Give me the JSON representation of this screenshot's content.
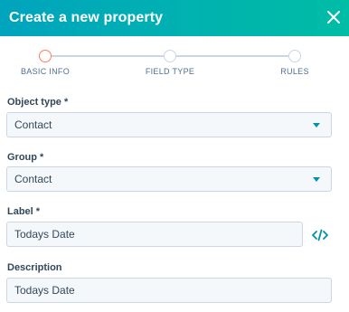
{
  "header": {
    "title": "Create a new property",
    "close_icon": "close-icon"
  },
  "stepper": {
    "steps": [
      {
        "label": "BASIC INFO",
        "active": true
      },
      {
        "label": "FIELD TYPE",
        "active": false
      },
      {
        "label": "RULES",
        "active": false
      }
    ]
  },
  "fields": {
    "object_type": {
      "label": "Object type *",
      "value": "Contact"
    },
    "group": {
      "label": "Group *",
      "value": "Contact"
    },
    "label": {
      "label": "Label *",
      "value": "Todays Date",
      "side_icon": "code-icon"
    },
    "description": {
      "label": "Description",
      "value": "Todays Date"
    }
  },
  "colors": {
    "header_start": "#00a4bd",
    "header_end": "#00bda5",
    "active_step": "#ff7a59",
    "accent": "#0091ae"
  }
}
